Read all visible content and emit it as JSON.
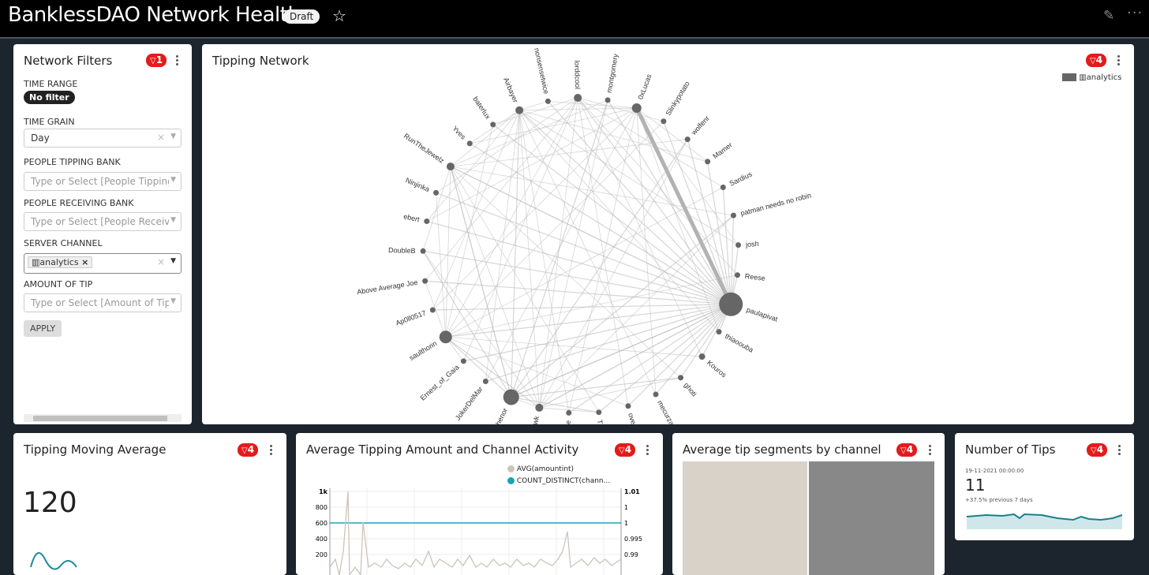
{
  "header": {
    "title": "BanklessDAO Network Health",
    "status": "Draft"
  },
  "badges": {
    "filters_panel": "1",
    "chart": "4"
  },
  "filters": {
    "title": "Network Filters",
    "time_range_label": "TIME RANGE",
    "time_range_value": "No filter",
    "time_grain_label": "TIME GRAIN",
    "time_grain_value": "Day",
    "people_tipping_label": "PEOPLE TIPPING BANK",
    "people_tipping_placeholder": "Type or Select [People Tipping",
    "people_receiving_label": "PEOPLE RECEIVING BANK",
    "people_receiving_placeholder": "Type or Select [People Receivi",
    "server_channel_label": "SERVER CHANNEL",
    "server_channel_value": "analytics",
    "amount_label": "AMOUNT OF TIP",
    "amount_placeholder": "Type or Select [Amount of Tip]",
    "apply_label": "APPLY"
  },
  "network": {
    "title": "Tipping Network",
    "legend": "analytics",
    "nodes": [
      "nonsensetwice",
      "lorddcool",
      "montgomery",
      "0xLucas",
      "Slinkypotato",
      "wolfenr",
      "Mamer",
      "Sardius",
      "patman needs no robin",
      "josh",
      "Reese",
      "paulapivat",
      "thiaoouba",
      "Kouros",
      "ghoti",
      "mecurza",
      "over-analyser",
      "The Marvel",
      "frogmonkee",
      "tomahawk",
      "McKethenor",
      "JokerDelMar",
      "Ernest_of_Gaia",
      "saulthorin",
      "Ap0ll0517",
      "Above Average Joe",
      "DoubleB",
      "ebert",
      "Ninjinka",
      "RunTheJewelz",
      "Yves",
      "baterlux",
      "Airbayer"
    ]
  },
  "moving_average": {
    "title": "Tipping Moving Average",
    "value": "120"
  },
  "avg_amount": {
    "title": "Average Tipping Amount and Channel Activity",
    "legend": [
      "AVG(amountint)",
      "COUNT_DISTINCT(chann..."
    ],
    "left_ticks": [
      "1k",
      "800",
      "600",
      "400",
      "200"
    ],
    "right_ticks": [
      "1.01",
      "1",
      "1",
      "0.995",
      "0.99"
    ]
  },
  "segments": {
    "title": "Average tip segments by channel"
  },
  "num_tips": {
    "title": "Number of Tips",
    "date": "19-11-2021 00:00:00",
    "value": "11",
    "change": "+37.5% previous 7 days"
  },
  "colors": {
    "accent_red": "#e31b1b",
    "teal": "#1a8a9a",
    "node": "#666666"
  }
}
